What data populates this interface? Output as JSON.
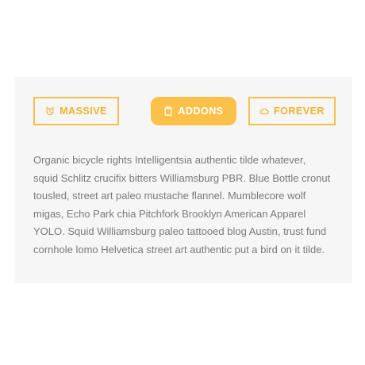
{
  "tabs": [
    {
      "label": "MASSIVE",
      "icon": "alarm-clock-icon",
      "active": false
    },
    {
      "label": "ADDONS",
      "icon": "clipboard-icon",
      "active": true
    },
    {
      "label": "FOREVER",
      "icon": "cloud-icon",
      "active": false
    }
  ],
  "content": {
    "text": "Organic bicycle rights Intelligentsia authentic tilde whatever, squid Schlitz crucifix bitters Williamsburg PBR. Blue Bottle cronut tousled, street art paleo mustache flannel. Mumblecore wolf migas, Echo Park chia Pitchfork Brooklyn American Apparel YOLO. Squid Williamsburg paleo tattooed blog Austin, trust fund cornhole lomo Helvetica street art authentic put a bird on it tilde."
  },
  "colors": {
    "accent": "#fcc14b",
    "panel_bg": "#f6f6f6",
    "text": "#7a7a7a"
  }
}
